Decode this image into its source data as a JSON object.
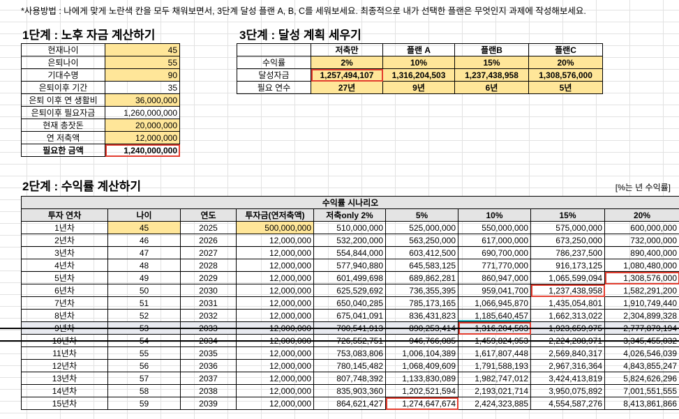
{
  "instruction": "*사용방법 : 나에게 맞게 노란색 칸을 모두 채워보면서, 3단계 달성 플랜 A, B, C를 세워보세요. 최종적으로 내가 선택한 플랜은 무엇인지 과제에 작성해보세요.",
  "step1": {
    "title": "1단계 : 노후 자금 계산하기",
    "rows": [
      {
        "label": "현재나이",
        "value": "45"
      },
      {
        "label": "은퇴나이",
        "value": "55"
      },
      {
        "label": "기대수명",
        "value": "90"
      },
      {
        "label": "은퇴이후 기간",
        "value": "35"
      },
      {
        "label": "은퇴 이후 연 생활비",
        "value": "36,000,000"
      },
      {
        "label": "은퇴이후 필요자금",
        "value": "1,260,000,000"
      },
      {
        "label": "현재 총잣돈",
        "value": "20,000,000"
      },
      {
        "label": "연 저축액",
        "value": "12,000,000"
      },
      {
        "label": "필요한 금액",
        "value": "1,240,000,000"
      }
    ]
  },
  "step3": {
    "title": "3단계 : 달성 계획 세우기",
    "headers": [
      "저축만",
      "플랜 A",
      "플랜B",
      "플랜C"
    ],
    "rows": [
      {
        "label": "수익률",
        "values": [
          "2%",
          "10%",
          "15%",
          "20%"
        ]
      },
      {
        "label": "달성자금",
        "values": [
          "1,257,494,107",
          "1,316,204,503",
          "1,237,438,958",
          "1,308,576,000"
        ]
      },
      {
        "label": "필요 연수",
        "values": [
          "27년",
          "9년",
          "6년",
          "5년"
        ]
      }
    ]
  },
  "step2": {
    "title": "2단계 : 수익률 계산하기",
    "note": "[%는 년 수익률]",
    "scenario_title": "수익률 시나리오",
    "headers": [
      "투자 연차",
      "나이",
      "연도",
      "투자금(연저축액)",
      "저축only 2%",
      "5%",
      "10%",
      "15%",
      "20%"
    ],
    "rows": [
      [
        "1년차",
        "45",
        "2025",
        "500,000,000",
        "510,000,000",
        "525,000,000",
        "550,000,000",
        "575,000,000",
        "600,000,000"
      ],
      [
        "2년차",
        "46",
        "2026",
        "12,000,000",
        "532,200,000",
        "563,250,000",
        "617,000,000",
        "673,250,000",
        "732,000,000"
      ],
      [
        "3년차",
        "47",
        "2027",
        "12,000,000",
        "554,844,000",
        "603,412,500",
        "690,700,000",
        "786,237,500",
        "890,400,000"
      ],
      [
        "4년차",
        "48",
        "2028",
        "12,000,000",
        "577,940,880",
        "645,583,125",
        "771,770,000",
        "916,173,125",
        "1,080,480,000"
      ],
      [
        "5년차",
        "49",
        "2029",
        "12,000,000",
        "601,499,698",
        "689,862,281",
        "860,947,000",
        "1,065,599,094",
        "1,308,576,000"
      ],
      [
        "6년차",
        "50",
        "2030",
        "12,000,000",
        "625,529,692",
        "736,355,395",
        "959,041,700",
        "1,237,438,958",
        "1,582,291,200"
      ],
      [
        "7년차",
        "51",
        "2031",
        "12,000,000",
        "650,040,285",
        "785,173,165",
        "1,066,945,870",
        "1,435,054,801",
        "1,910,749,440"
      ],
      [
        "8년차",
        "52",
        "2032",
        "12,000,000",
        "675,041,091",
        "836,431,823",
        "1,185,640,457",
        "1,662,313,022",
        "2,304,899,328"
      ],
      [
        "9년차",
        "53",
        "2033",
        "12,000,000",
        "700,541,913",
        "890,253,414",
        "1,316,204,503",
        "1,923,659,975",
        "2,777,879,194"
      ],
      [
        "10년차",
        "54",
        "2034",
        "12,000,000",
        "726,552,751",
        "946,766,085",
        "1,459,824,953",
        "2,224,208,971",
        "3,345,455,032"
      ],
      [
        "11년차",
        "55",
        "2035",
        "12,000,000",
        "753,083,806",
        "1,006,104,389",
        "1,617,807,448",
        "2,569,840,317",
        "4,026,546,039"
      ],
      [
        "12년차",
        "56",
        "2036",
        "12,000,000",
        "780,145,482",
        "1,068,409,609",
        "1,791,588,193",
        "2,967,316,364",
        "4,843,855,247"
      ],
      [
        "13년차",
        "57",
        "2037",
        "12,000,000",
        "807,748,392",
        "1,133,830,089",
        "1,982,747,012",
        "3,424,413,819",
        "5,824,626,296"
      ],
      [
        "14년차",
        "58",
        "2038",
        "12,000,000",
        "835,903,360",
        "1,202,521,594",
        "2,193,021,714",
        "3,950,075,892",
        "7,001,551,555"
      ],
      [
        "15년차",
        "59",
        "2039",
        "12,000,000",
        "864,621,427",
        "1,274,647,674",
        "2,424,323,885",
        "4,554,587,276",
        "8,413,861,866"
      ]
    ]
  }
}
